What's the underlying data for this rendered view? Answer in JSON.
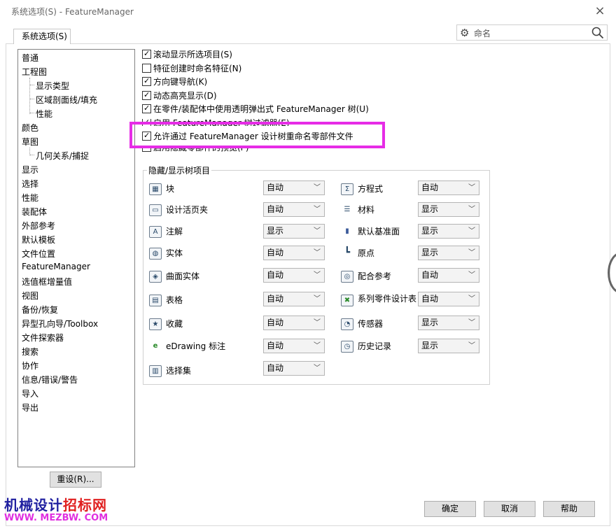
{
  "window": {
    "title": "系统选项(S) - FeatureManager",
    "close_glyph": "×"
  },
  "tab": {
    "label": "系统选项(S)"
  },
  "search": {
    "placeholder": "命名"
  },
  "tree": {
    "items": [
      {
        "label": "普通"
      },
      {
        "label": "工程图"
      },
      {
        "label": "显示类型"
      },
      {
        "label": "区域剖面线/填充"
      },
      {
        "label": "性能"
      },
      {
        "label": "颜色"
      },
      {
        "label": "草图"
      },
      {
        "label": "几何关系/捕捉"
      },
      {
        "label": "显示"
      },
      {
        "label": "选择"
      },
      {
        "label": "性能"
      },
      {
        "label": "装配体"
      },
      {
        "label": "外部参考"
      },
      {
        "label": "默认模板"
      },
      {
        "label": "文件位置"
      },
      {
        "label": "FeatureManager"
      },
      {
        "label": "选值框增量值"
      },
      {
        "label": "视图"
      },
      {
        "label": "备份/恢复"
      },
      {
        "label": "异型孔向导/Toolbox"
      },
      {
        "label": "文件探索器"
      },
      {
        "label": "搜索"
      },
      {
        "label": "协作"
      },
      {
        "label": "信息/错误/警告"
      },
      {
        "label": "导入"
      },
      {
        "label": "导出"
      }
    ]
  },
  "reset_button": "重设(R)...",
  "options": [
    {
      "label": "滚动显示所选项目(S)",
      "checked": true
    },
    {
      "label": "特征创建时命名特征(N)",
      "checked": false
    },
    {
      "label": "方向键导航(K)",
      "checked": true
    },
    {
      "label": "动态高亮显示(D)",
      "checked": true
    },
    {
      "label": "在零件/装配体中使用透明弹出式 FeatureManager 树(U)",
      "checked": true
    },
    {
      "label": "启用 FeatureManager 树过滤器(E)",
      "checked": true
    },
    {
      "label": "允许通过 FeatureManager 设计树重命名零部件文件",
      "checked": true
    },
    {
      "label": "启用隐藏零部件的预览(P)",
      "checked": true
    }
  ],
  "visibility": {
    "title": "隐藏/显示树项目",
    "left": [
      {
        "label": "块",
        "value": "自动",
        "icon": "block-icon"
      },
      {
        "label": "设计活页夹",
        "value": "自动",
        "icon": "binder-icon"
      },
      {
        "label": "注解",
        "value": "显示",
        "icon": "annotation-icon"
      },
      {
        "label": "实体",
        "value": "自动",
        "icon": "solid-body-icon"
      },
      {
        "label": "曲面实体",
        "value": "自动",
        "icon": "surface-body-icon"
      },
      {
        "label": "表格",
        "value": "自动",
        "icon": "table-icon"
      },
      {
        "label": "收藏",
        "value": "自动",
        "icon": "favorites-icon"
      },
      {
        "label": "eDrawing 标注",
        "value": "自动",
        "icon": "edrawing-icon"
      },
      {
        "label": "选择集",
        "value": "自动",
        "icon": "selection-set-icon"
      }
    ],
    "right": [
      {
        "label": "方程式",
        "value": "自动",
        "icon": "equation-icon"
      },
      {
        "label": "材料",
        "value": "显示",
        "icon": "material-icon"
      },
      {
        "label": "默认基准面",
        "value": "显示",
        "icon": "plane-icon"
      },
      {
        "label": "原点",
        "value": "显示",
        "icon": "origin-icon"
      },
      {
        "label": "配合参考",
        "value": "自动",
        "icon": "mate-reference-icon"
      },
      {
        "label": "系列零件设计表",
        "value": "自动",
        "icon": "design-table-icon"
      },
      {
        "label": "传感器",
        "value": "显示",
        "icon": "sensor-icon"
      },
      {
        "label": "历史记录",
        "value": "显示",
        "icon": "history-icon"
      }
    ]
  },
  "buttons": {
    "ok": "确定",
    "cancel": "取消",
    "help": "帮助"
  },
  "watermark": {
    "line1a": "机械设计",
    "line1b": "招标网",
    "line2": "WWW. MEZBW. COM"
  },
  "colors": {
    "highlight": "#e62ce6",
    "watermark_blue": "#2020a0",
    "watermark_red": "#e02020",
    "watermark_magenta": "#e030e0"
  }
}
